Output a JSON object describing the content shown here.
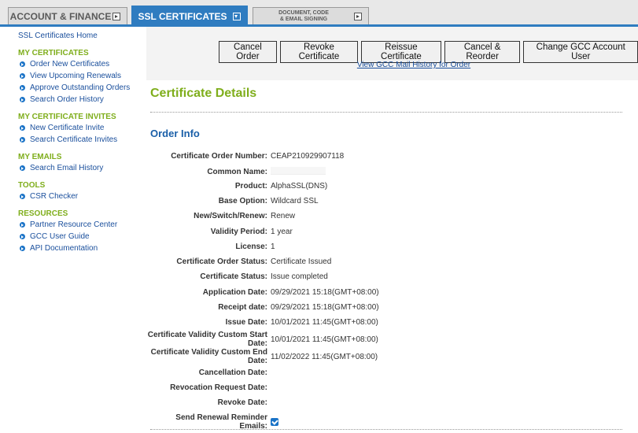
{
  "tabs": {
    "account": "ACCOUNT & FINANCE",
    "ssl": "SSL CERTIFICATES",
    "doc_line1": "DOCUMENT, CODE",
    "doc_line2": "& EMAIL SIGNING"
  },
  "sidebar": {
    "home": "SSL Certificates Home",
    "sections": [
      {
        "title": "MY CERTIFICATES",
        "items": [
          "Order New Certificates",
          "View Upcoming Renewals",
          "Approve Outstanding Orders",
          "Search Order History"
        ]
      },
      {
        "title": "MY CERTIFICATE INVITES",
        "items": [
          "New Certificate Invite",
          "Search Certificate Invites"
        ]
      },
      {
        "title": "MY EMAILS",
        "items": [
          "Search Email History"
        ]
      },
      {
        "title": "TOOLS",
        "items": [
          "CSR Checker"
        ]
      },
      {
        "title": "RESOURCES",
        "items": [
          "Partner Resource Center",
          "GCC User Guide",
          "API Documentation"
        ]
      }
    ]
  },
  "actions": {
    "cancel_order": "Cancel Order",
    "revoke": "Revoke Certificate",
    "reissue": "Reissue Certificate",
    "cancel_reorder": "Cancel & Reorder",
    "change_user": "Change GCC Account User",
    "mail_history": "View GCC Mail History for Order"
  },
  "details": {
    "title": "Certificate Details",
    "order_info_title": "Order Info",
    "rows": [
      {
        "label": "Certificate Order Number:",
        "value": "CEAP210929907118"
      },
      {
        "label": "Common Name:",
        "value": ""
      },
      {
        "label": "Product:",
        "value": "AlphaSSL(DNS)"
      },
      {
        "label": "Base Option:",
        "value": "Wildcard SSL"
      },
      {
        "label": "New/Switch/Renew:",
        "value": "Renew"
      },
      {
        "label": "Validity Period:",
        "value": "1 year"
      },
      {
        "label": "License:",
        "value": "1"
      },
      {
        "label": "Certificate Order Status:",
        "value": "Certificate Issued"
      },
      {
        "label": "Certificate Status:",
        "value": "Issue completed"
      },
      {
        "label": "Application Date:",
        "value": "09/29/2021 15:18(GMT+08:00)"
      },
      {
        "label": "Receipt date:",
        "value": "09/29/2021 15:18(GMT+08:00)"
      },
      {
        "label": "Issue Date:",
        "value": "10/01/2021 11:45(GMT+08:00)"
      },
      {
        "label": "Certificate Validity Custom Start Date:",
        "value": "10/01/2021 11:45(GMT+08:00)"
      },
      {
        "label": "Certificate Validity Custom End Date:",
        "value": "11/02/2022 11:45(GMT+08:00)"
      },
      {
        "label": "Cancellation Date:",
        "value": ""
      },
      {
        "label": "Revocation Request Date:",
        "value": ""
      },
      {
        "label": "Revoke Date:",
        "value": ""
      },
      {
        "label": "Send Renewal Reminder Emails:",
        "value": ""
      }
    ]
  }
}
